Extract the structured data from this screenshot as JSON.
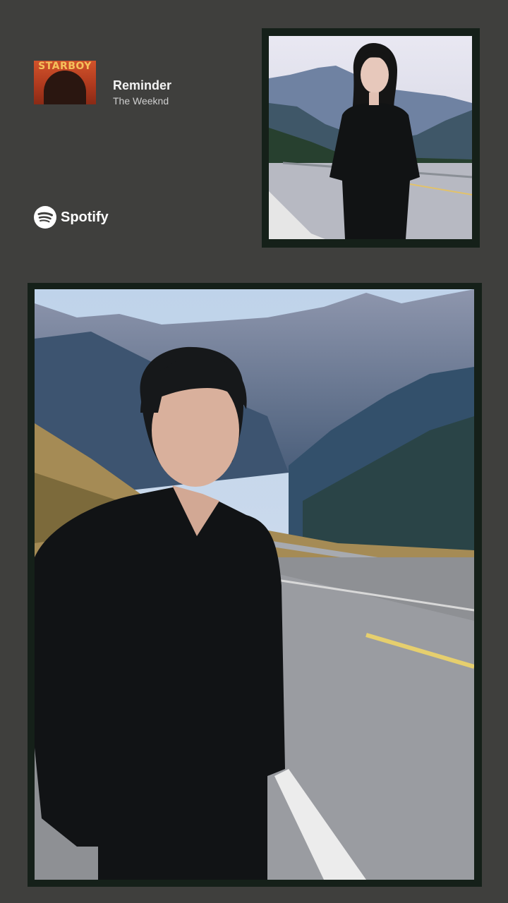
{
  "now_playing": {
    "album_art_text": "STARBOY",
    "track_title": "Reminder",
    "artist": "The Weeknd"
  },
  "brand": {
    "name": "Spotify",
    "icon": "spotify-icon",
    "color": "#ffffff"
  },
  "photos": [
    {
      "name": "woman-on-mountain-road"
    },
    {
      "name": "man-on-mountain-road"
    }
  ],
  "colors": {
    "background": "#3f3f3d",
    "frame": "#152019",
    "album_art": "#c4482a"
  }
}
